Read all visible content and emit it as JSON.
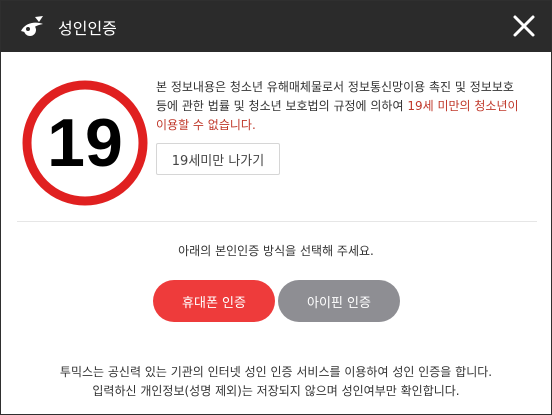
{
  "header": {
    "title": "성인인증",
    "logo_icon": "toptoon-logo-icon",
    "close_icon": "close-icon",
    "background_color": "#2b2b2b"
  },
  "badge": {
    "number": "19",
    "ring_color": "#e02020"
  },
  "notice": {
    "text_part1": "본 정보내용은 청소년 유해매체물로서 정보통신망이용 촉진 및 정보보호 등에 관한 법률 및 청소년 보호법의 규정에 의하여 ",
    "text_highlight": "19세 미만의 청소년이 이용할 수 없습니다.",
    "highlight_color": "#c0392b"
  },
  "exit_button": {
    "label": "19세미만 나가기"
  },
  "instruction": "아래의 본인인증 방식을 선택해 주세요.",
  "buttons": {
    "phone": {
      "label": "휴대폰 인증",
      "color": "#ee3b3b"
    },
    "ipin": {
      "label": "아이핀 인증",
      "color": "#8e8e93"
    }
  },
  "footer": {
    "line1": "투믹스는 공신력 있는 기관의 인터넷 성인 인증 서비스를 이용하여 성인 인증을 합니다.",
    "line2": "입력하신 개인정보(성명 제외)는 저장되지 않으며 성인여부만 확인합니다."
  }
}
